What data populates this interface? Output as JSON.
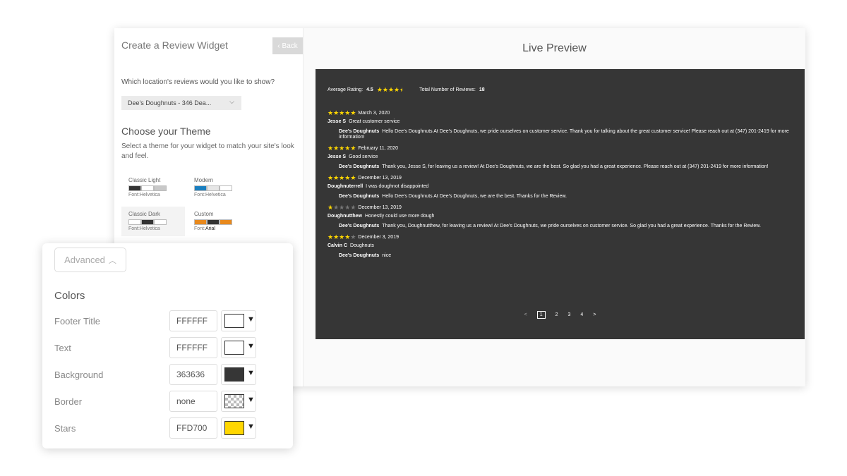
{
  "left": {
    "title": "Create a Review Widget",
    "back_label": "Back",
    "question": "Which location's reviews would you like to show?",
    "location_value": "Dee's Doughnuts - 346 Dea...",
    "theme_title": "Choose your Theme",
    "theme_desc": "Select a theme for your widget to match your site's look and feel.",
    "themes": [
      {
        "name": "Classic Light",
        "font": "Font:Helvetica",
        "swatches": [
          "#333333",
          "#ffffff",
          "#c8c8c8"
        ]
      },
      {
        "name": "Modern",
        "font": "Font:Helvetica",
        "swatches": [
          "#1a7fc0",
          "#e6e6e6",
          "#ffffff"
        ]
      },
      {
        "name": "Classic Dark",
        "font": "Font:Helvetica",
        "swatches": [
          "#ffffff",
          "#333333",
          "#ffffff"
        ]
      },
      {
        "name": "Custom",
        "font_prefix": "Font:",
        "font_name": "Arial",
        "swatches": [
          "#e8891d",
          "#333333",
          "#e8891d"
        ]
      }
    ]
  },
  "preview": {
    "title": "Live Preview",
    "avg_label": "Average Rating:",
    "avg_value": "4.5",
    "total_label": "Total Number of Reviews:",
    "total_value": "18",
    "reviews": [
      {
        "stars": 5,
        "date": "March 3, 2020",
        "author": "Jesse S",
        "comment": "Great customer service",
        "reply_from": "Dee's Doughnuts",
        "reply": "Hello Dee's Doughnuts At Dee's Doughnuts, we pride ourselves on customer service. Thank you for talking about the great customer service! Please reach out at (347) 201-2419 for more information!"
      },
      {
        "stars": 5,
        "date": "February 11, 2020",
        "author": "Jesse S",
        "comment": "Good service",
        "reply_from": "Dee's Doughnuts",
        "reply": "Thank you, Jesse S, for leaving us a review! At Dee's Doughnuts, we are the best. So glad you had a great experience. Please reach out at (347) 201-2419 for more information!"
      },
      {
        "stars": 5,
        "date": "December 13, 2019",
        "author": "Doughnuterrell",
        "comment": "I was doughnot disappointed",
        "reply_from": "Dee's Doughnuts",
        "reply": "Hello Dee's Doughnuts At Dee's Doughnuts, we are the best. Thanks for the Review."
      },
      {
        "stars": 1,
        "date": "December 13, 2019",
        "author": "Doughnutthew",
        "comment": "Honestly could use more dough",
        "reply_from": "Dee's Doughnuts",
        "reply": "Thank you, Doughnutthew, for leaving us a review! At Dee's Doughnuts, we pride ourselves on customer service. So glad you had a great experience. Thanks for the Review."
      },
      {
        "stars": 4,
        "date": "December 3, 2019",
        "author": "Calvin C",
        "comment": "Doughnuts",
        "reply_from": "Dee's Doughnuts",
        "reply": "nice"
      }
    ],
    "pager": {
      "prev": "<",
      "pages": [
        "1",
        "2",
        "3",
        "4"
      ],
      "next": ">"
    }
  },
  "advanced": {
    "button_label": "Advanced",
    "colors_title": "Colors",
    "rows": [
      {
        "label": "Footer Title",
        "hex": "FFFFFF",
        "swatch": "#ffffff"
      },
      {
        "label": "Text",
        "hex": "FFFFFF",
        "swatch": "#ffffff"
      },
      {
        "label": "Background",
        "hex": "363636",
        "swatch": "#363636"
      },
      {
        "label": "Border",
        "hex": "none",
        "swatch": "transparent"
      },
      {
        "label": "Stars",
        "hex": "FFD700",
        "swatch": "#FFD700"
      }
    ]
  },
  "colors": {
    "preview_bg": "#363636",
    "star": "#FFD700"
  }
}
